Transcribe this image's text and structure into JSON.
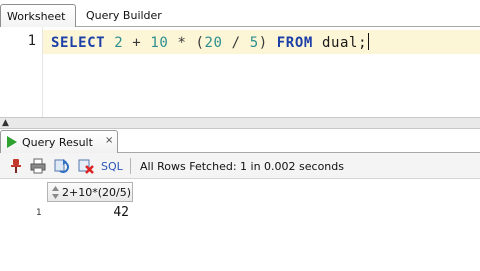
{
  "tabs": {
    "worksheet": "Worksheet",
    "query_builder": "Query Builder"
  },
  "editor": {
    "line_number": "1",
    "tokens": {
      "select": "SELECT",
      "n2": "2",
      "plus": "+",
      "n10": "10",
      "star": "*",
      "open": "(",
      "n20": "20",
      "slash": "/",
      "n5": "5",
      "close": ")",
      "from": "FROM",
      "table": "dual",
      "semi": ";"
    }
  },
  "result_panel": {
    "tab_label": "Query Result",
    "close_symbol": "×",
    "sql_link": "SQL",
    "status": "All Rows Fetched: 1 in 0.002 seconds"
  },
  "grid": {
    "columns": [
      "2+10*(20/5)"
    ],
    "rows": [
      {
        "row_number": "1",
        "cells": [
          "42"
        ]
      }
    ]
  },
  "colors": {
    "keyword": "#1c3fa8",
    "number": "#2b8f8f",
    "current_line": "#fcf5d6",
    "run_icon": "#2fa12f",
    "link": "#2a56b4"
  },
  "icons": [
    "pin-icon",
    "print-icon",
    "refresh-icon",
    "export-icon",
    "play-icon",
    "sort-icon"
  ]
}
